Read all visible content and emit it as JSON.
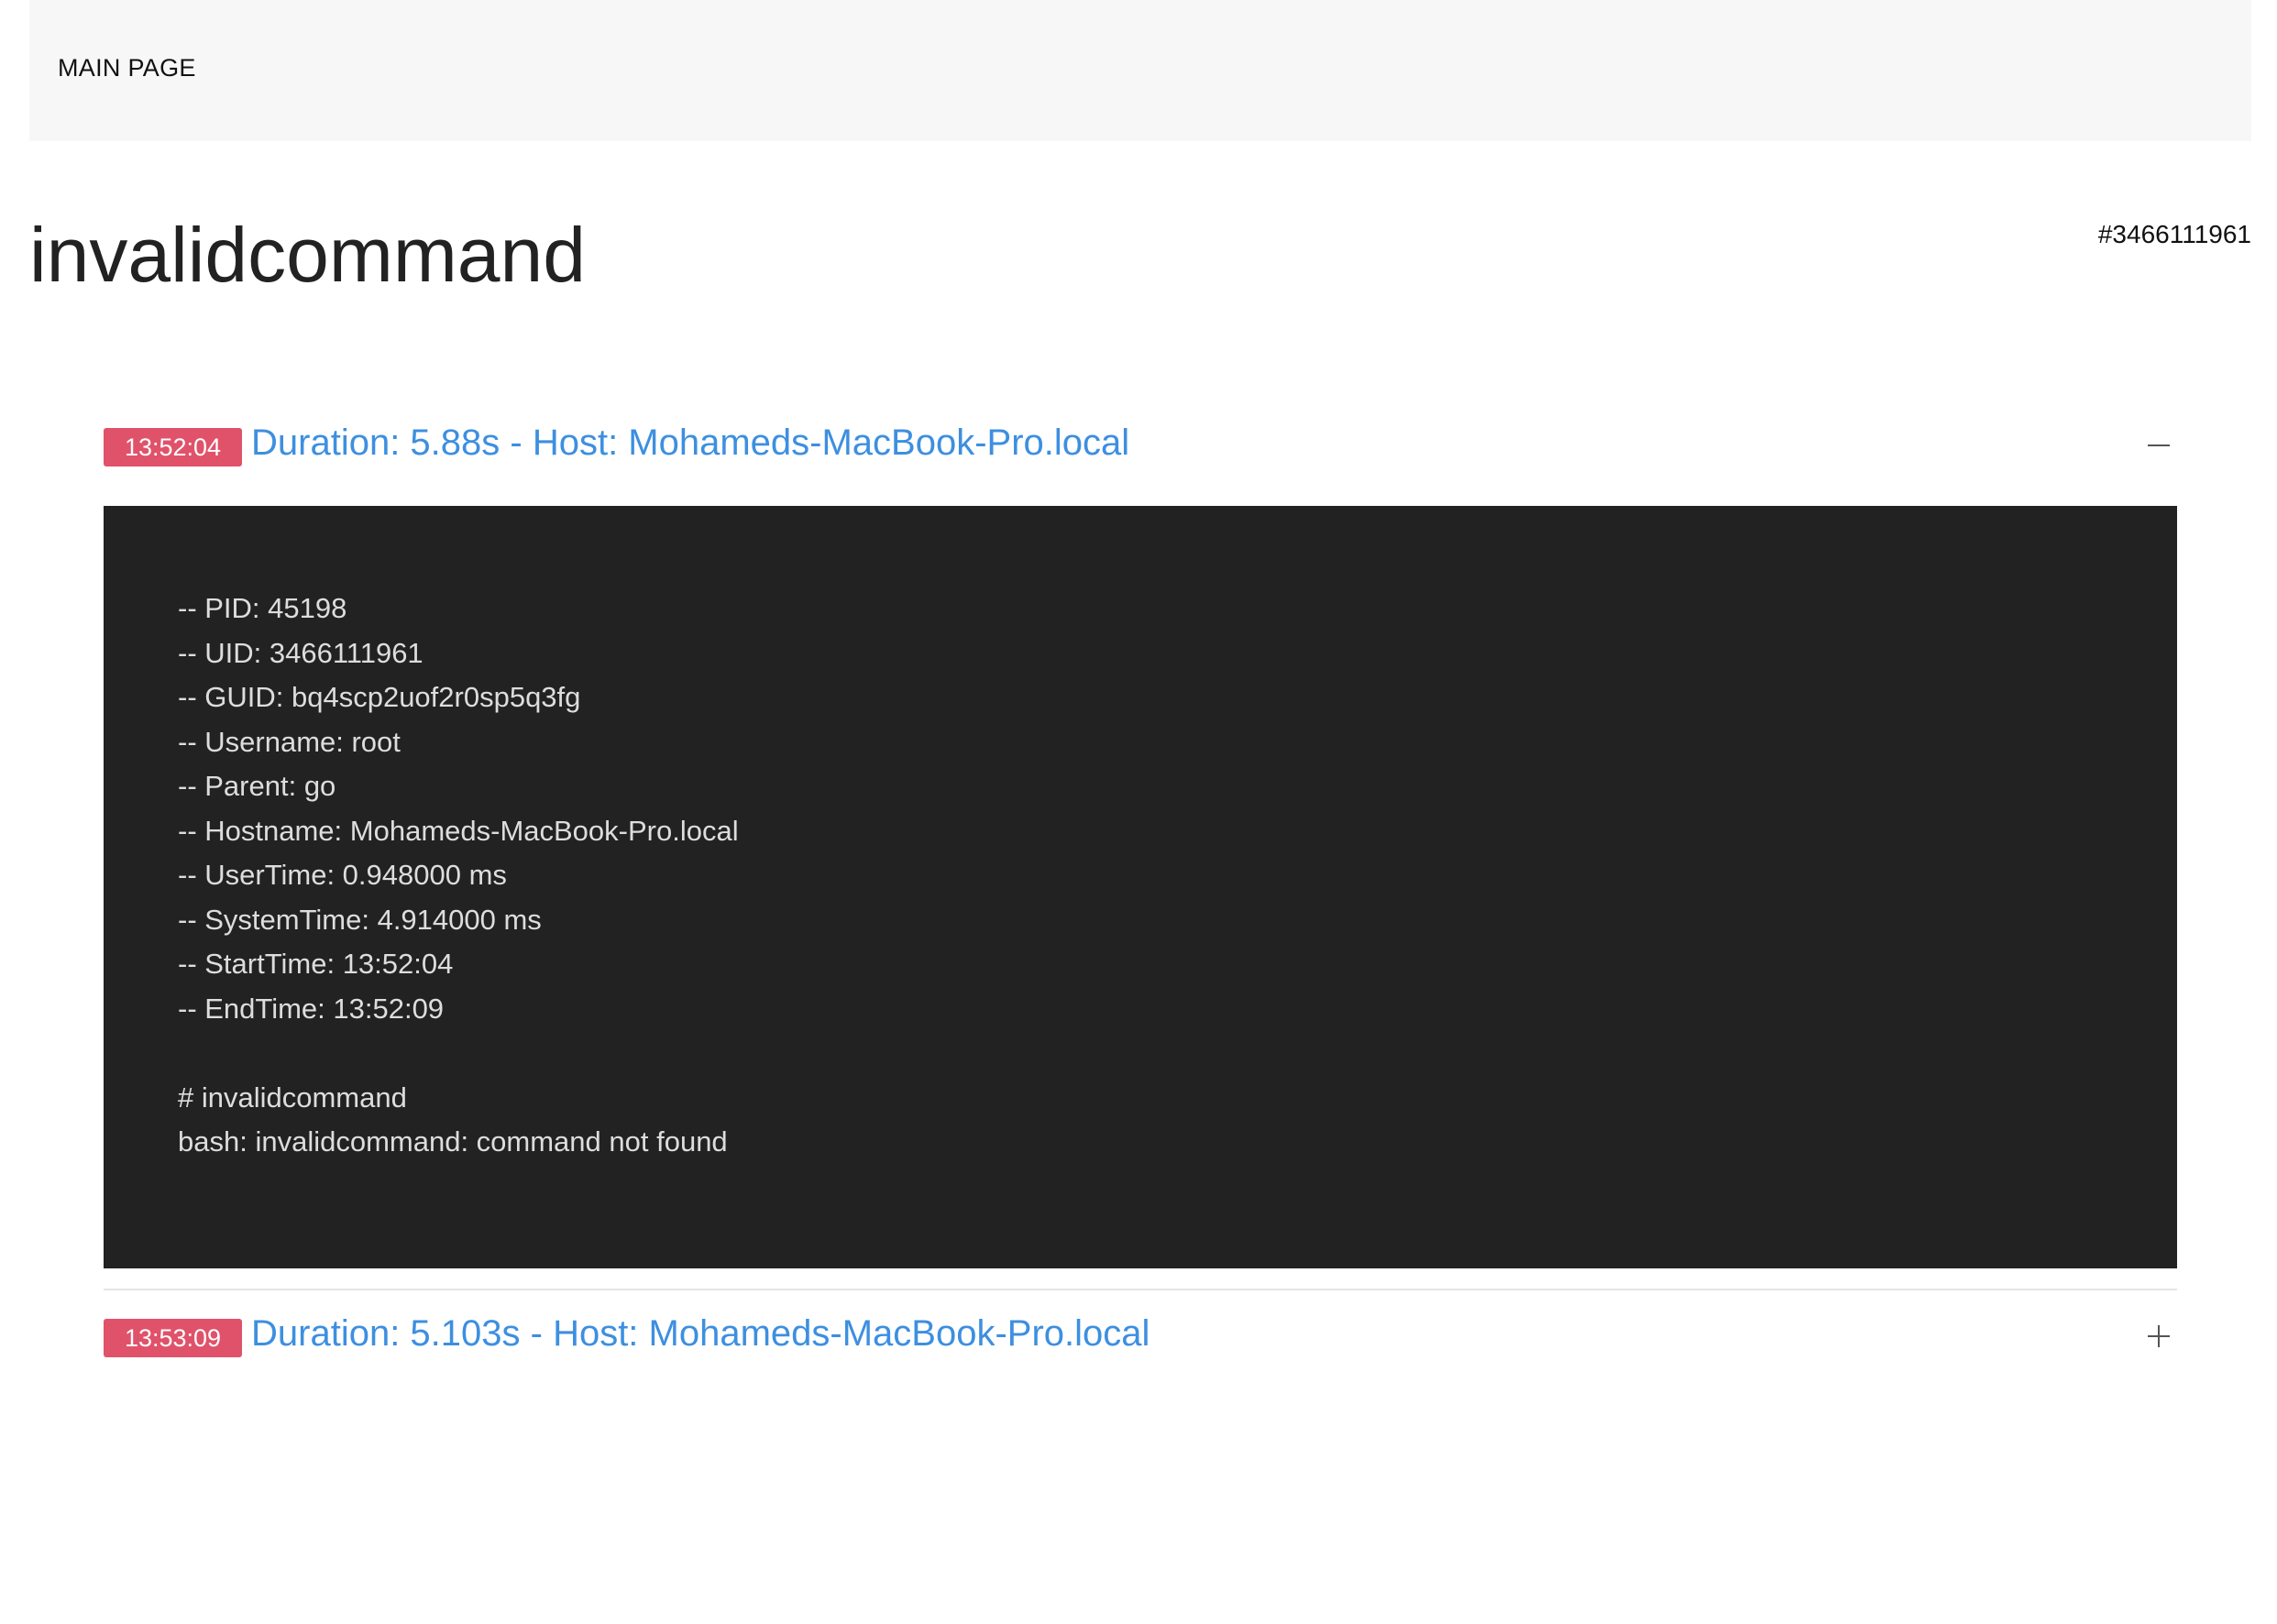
{
  "nav": {
    "main_page_label": "MAIN PAGE"
  },
  "header": {
    "title": "invalidcommand",
    "uid_tag": "#3466111961"
  },
  "runs": [
    {
      "time_badge": "13:52:04",
      "title": "Duration: 5.88s - Host: Mohameds-MacBook-Pro.local",
      "expanded": true,
      "toggle_icon": "minus-icon",
      "log": "-- PID: 45198\n-- UID: 3466111961\n-- GUID: bq4scp2uof2r0sp5q3fg\n-- Username: root\n-- Parent: go\n-- Hostname: Mohameds-MacBook-Pro.local\n-- UserTime: 0.948000 ms\n-- SystemTime: 4.914000 ms\n-- StartTime: 13:52:04\n-- EndTime: 13:52:09\n\n# invalidcommand\nbash: invalidcommand: command not found"
    },
    {
      "time_badge": "13:53:09",
      "title": "Duration: 5.103s - Host: Mohameds-MacBook-Pro.local",
      "expanded": false,
      "toggle_icon": "plus-icon"
    }
  ],
  "colors": {
    "badge_bg": "#e0526a",
    "link": "#3d8fe0",
    "log_bg": "#222222",
    "log_text": "#dddddd",
    "topbar_bg": "#f7f7f7"
  }
}
